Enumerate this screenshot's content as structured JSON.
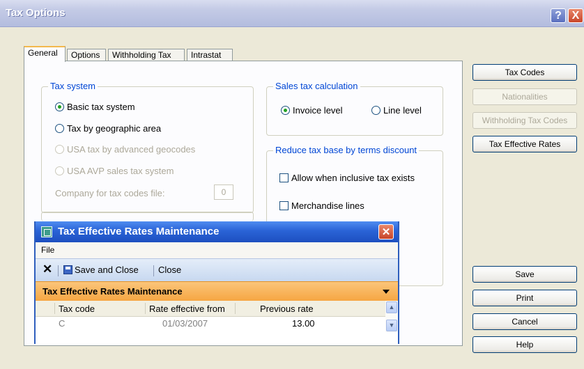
{
  "window": {
    "title": "Tax Options",
    "help_glyph": "?",
    "close_glyph": "X"
  },
  "tabs": [
    {
      "label": "General",
      "active": true
    },
    {
      "label": "Options",
      "active": false
    },
    {
      "label": "Withholding Tax",
      "active": false
    },
    {
      "label": "Intrastat",
      "active": false
    }
  ],
  "tax_system": {
    "title": "Tax system",
    "options": [
      {
        "label": "Basic tax system",
        "selected": true,
        "enabled": true
      },
      {
        "label": "Tax by geographic area",
        "selected": false,
        "enabled": true
      },
      {
        "label": "USA tax by advanced geocodes",
        "selected": false,
        "enabled": false
      },
      {
        "label": "USA AVP sales tax system",
        "selected": false,
        "enabled": false
      }
    ],
    "company_label": "Company for tax codes file:",
    "company_value": "0"
  },
  "sales_tax_calc": {
    "title": "Sales tax calculation",
    "options": [
      {
        "label": "Invoice level",
        "selected": true
      },
      {
        "label": "Line level",
        "selected": false
      }
    ]
  },
  "reduce_tax": {
    "title": "Reduce tax base by terms discount",
    "checkboxes": [
      {
        "label": "Allow when inclusive tax exists",
        "checked": false
      },
      {
        "label": "Merchandise lines",
        "checked": false
      }
    ]
  },
  "side_buttons": [
    {
      "label": "Tax Codes",
      "enabled": true
    },
    {
      "label": "Nationalities",
      "enabled": false
    },
    {
      "label": "Withholding Tax Codes",
      "enabled": false
    },
    {
      "label": "Tax Effective Rates",
      "enabled": true
    }
  ],
  "bottom_buttons": [
    {
      "label": "Save"
    },
    {
      "label": "Print"
    },
    {
      "label": "Cancel"
    },
    {
      "label": "Help"
    }
  ],
  "dialog": {
    "title": "Tax Effective Rates Maintenance",
    "close_glyph": "✕",
    "menu": [
      "File"
    ],
    "toolbar": {
      "delete_glyph": "✕",
      "save_close": "Save and Close",
      "close": "Close"
    },
    "section_title": "Tax Effective Rates Maintenance",
    "grid": {
      "columns": [
        "Tax code",
        "Rate effective from",
        "Previous rate"
      ],
      "rows": [
        {
          "tax_code": "C",
          "rate_effective_from": "01/03/2007",
          "previous_rate": "13.00"
        }
      ]
    }
  }
}
